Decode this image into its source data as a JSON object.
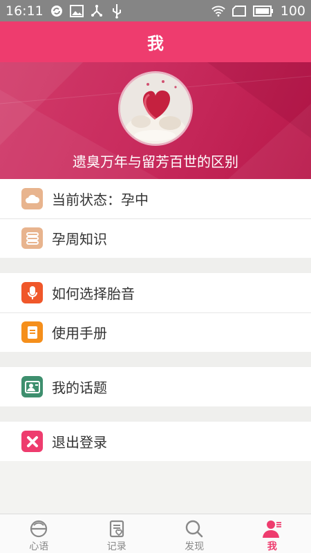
{
  "status_bar": {
    "time": "16:11",
    "battery": "100",
    "left_icons": [
      "sync-icon",
      "image-icon",
      "share-icon",
      "usb-icon"
    ],
    "right_icons": [
      "wifi-icon",
      "sim-icon",
      "battery-icon"
    ]
  },
  "header": {
    "title": "我"
  },
  "profile": {
    "name": "遗臭万年与留芳百世的区别"
  },
  "menu": {
    "status": {
      "label": "当前状态：孕中",
      "icon": "cloud-icon",
      "color": "#e8b48e"
    },
    "weeks": {
      "label": "孕周知识",
      "icon": "list-icon",
      "color": "#e8b48e"
    },
    "music": {
      "label": "如何选择胎音",
      "icon": "microphone-icon",
      "color": "#f0572a"
    },
    "manual": {
      "label": "使用手册",
      "icon": "document-icon",
      "color": "#f58f1b"
    },
    "topics": {
      "label": "我的话题",
      "icon": "contact-card-icon",
      "color": "#3e8f6e"
    },
    "logout": {
      "label": "退出登录",
      "icon": "close-icon",
      "color": "#ee3c6e"
    }
  },
  "tabbar": {
    "tabs": [
      {
        "label": "心语",
        "icon": "heart-talk-icon"
      },
      {
        "label": "记录",
        "icon": "record-icon"
      },
      {
        "label": "发现",
        "icon": "search-icon"
      },
      {
        "label": "我",
        "icon": "profile-icon"
      }
    ],
    "active_color": "#ee3c6e"
  }
}
